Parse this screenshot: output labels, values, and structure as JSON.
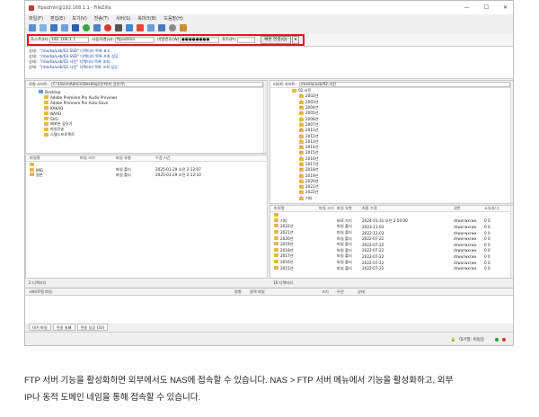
{
  "window": {
    "title": "ftpadmin@192.168.1.1 - FileZilla",
    "controls": [
      "—",
      "☐",
      "✕"
    ]
  },
  "menu": [
    "파일(F)",
    "편집(E)",
    "보기(V)",
    "전송(T)",
    "서버(S)",
    "북마크(B)",
    "도움말(H)"
  ],
  "toolbar_icons": [
    "site-manager-icon",
    "toggle-log-icon",
    "toggle-tree-icon",
    "toggle-remote-tree-icon",
    "toggle-queue-icon",
    "refresh-icon",
    "process-queue-icon",
    "cancel-icon",
    "disconnect-icon",
    "reconnect-icon",
    "filter-icon",
    "compare-icon",
    "sync-browse-icon",
    "search-icon",
    "binoculars-icon"
  ],
  "quickconnect": {
    "host_label": "호스트(H):",
    "host_value": "192.168.1.1",
    "user_label": "사용자명(U):",
    "user_value": "ftpadmin",
    "pass_label": "비밀번호(W):",
    "pass_value": "●●●●●●●●",
    "port_label": "포트(P):",
    "port_value": "",
    "button": "빠른 연결(Q)",
    "dropdown": "▾"
  },
  "log": [
    {
      "k": "상태:",
      "v": "\"/media/usb/02.SSD\" 디렉터리 목록 표시"
    },
    {
      "k": "상태:",
      "v": "\"/media/usb/02.SSD\" 디렉터리 목록 조회 성공"
    },
    {
      "k": "상태:",
      "v": "\"/media/usb/02.사진\" 디렉터리 목록 조회..."
    },
    {
      "k": "상태:",
      "v": "\"/media/usb/02.사진\" 디렉터리 목록 조회 성공"
    }
  ],
  "local": {
    "site_label": "로컬 사이트:",
    "path": "C:\\Users\\Admin\\Desktop\\유저\\지 공유기\\",
    "tree": [
      {
        "indent": 14,
        "label": "Desktop",
        "kind": "folder-blue"
      },
      {
        "indent": 20,
        "label": "Adobe Premiere Pro Audio Previews",
        "kind": "folder"
      },
      {
        "indent": 20,
        "label": "Adobe Premiere Pro Auto-Save",
        "kind": "folder"
      },
      {
        "indent": 20,
        "label": "KAKAO",
        "kind": "folder"
      },
      {
        "indent": 20,
        "label": "NAAD",
        "kind": "folder"
      },
      {
        "indent": 20,
        "label": "SVG",
        "kind": "folder"
      },
      {
        "indent": 20,
        "label": "배포본 공유기",
        "kind": "folder"
      },
      {
        "indent": 20,
        "label": "파일전송",
        "kind": "folder"
      },
      {
        "indent": 20,
        "label": "스텔스프로젝트",
        "kind": "folder"
      }
    ],
    "columns": [
      "파일명",
      "파일 크기",
      "파일 유형",
      "수정 시간"
    ],
    "files": [
      {
        "name": "..",
        "size": "",
        "type": "",
        "mtime": ""
      },
      {
        "name": "IMG",
        "size": "",
        "type": "파일 폴더",
        "mtime": "2025-01-29 오전 2:12:07"
      },
      {
        "name": "원본",
        "size": "",
        "type": "파일 폴더",
        "mtime": "2025-01-29 오전 2:12:10"
      }
    ],
    "status": "2 디렉터리"
  },
  "remote": {
    "site_label": "리모트 사이트:",
    "path": "/media/usb/02.사진",
    "tree": [
      {
        "indent": 24,
        "label": "02.사진",
        "kind": "folder"
      },
      {
        "indent": 32,
        "label": "2002년",
        "kind": "q"
      },
      {
        "indent": 32,
        "label": "2003년",
        "kind": "q"
      },
      {
        "indent": 32,
        "label": "2004년",
        "kind": "q"
      },
      {
        "indent": 32,
        "label": "2005년",
        "kind": "q"
      },
      {
        "indent": 32,
        "label": "2006년",
        "kind": "q"
      },
      {
        "indent": 32,
        "label": "2007년",
        "kind": "q"
      },
      {
        "indent": 32,
        "label": "2011년",
        "kind": "q"
      },
      {
        "indent": 32,
        "label": "2012년",
        "kind": "q"
      },
      {
        "indent": 32,
        "label": "2013년",
        "kind": "q"
      },
      {
        "indent": 32,
        "label": "2014년",
        "kind": "q"
      },
      {
        "indent": 32,
        "label": "2015년",
        "kind": "q"
      },
      {
        "indent": 32,
        "label": "2016년",
        "kind": "q"
      },
      {
        "indent": 32,
        "label": "2017년",
        "kind": "q"
      },
      {
        "indent": 32,
        "label": "2018년",
        "kind": "q"
      },
      {
        "indent": 32,
        "label": "2019년",
        "kind": "q"
      },
      {
        "indent": 32,
        "label": "2020년",
        "kind": "q"
      },
      {
        "indent": 32,
        "label": "2021년",
        "kind": "q"
      },
      {
        "indent": 32,
        "label": "2022년",
        "kind": "q"
      },
      {
        "indent": 32,
        "label": "기타",
        "kind": "q"
      }
    ],
    "columns": [
      "파일명",
      "파일 크기",
      "파일 유형",
      "최종 수정",
      "권한",
      "소유자/그"
    ],
    "files": [
      {
        "name": "..",
        "size": "",
        "type": "",
        "mtime": "",
        "perm": "",
        "owner": ""
      },
      {
        "name": "기타",
        "size": "",
        "type": "바로 가기",
        "mtime": "2024-01-31 오전 2:50:00",
        "perm": "drwxrwxrwx",
        "owner": "0 0"
      },
      {
        "name": "2022년",
        "size": "",
        "type": "파일 폴더",
        "mtime": "2023-11-03",
        "perm": "drwxrwxrwx",
        "owner": "0 0"
      },
      {
        "name": "2021년",
        "size": "",
        "type": "파일 폴더",
        "mtime": "2022-12-03",
        "perm": "drwxrwxrwx",
        "owner": "0 0"
      },
      {
        "name": "2020년",
        "size": "",
        "type": "파일 폴더",
        "mtime": "2022-07-22",
        "perm": "drwxrwxrwx",
        "owner": "0 0"
      },
      {
        "name": "2019년",
        "size": "",
        "type": "파일 폴더",
        "mtime": "2022-07-22",
        "perm": "drwxrwxrwx",
        "owner": "0 0"
      },
      {
        "name": "2018년",
        "size": "",
        "type": "파일 폴더",
        "mtime": "2022-07-22",
        "perm": "drwxrwxrwx",
        "owner": "0 0"
      },
      {
        "name": "2017년",
        "size": "",
        "type": "파일 폴더",
        "mtime": "2022-07-22",
        "perm": "drwxrwxrwx",
        "owner": "0 0"
      },
      {
        "name": "2016년",
        "size": "",
        "type": "파일 폴더",
        "mtime": "2022-07-22",
        "perm": "drwxrwxrwx",
        "owner": "0 0"
      },
      {
        "name": "2015년",
        "size": "",
        "type": "파일 폴더",
        "mtime": "2022-07-22",
        "perm": "drwxrwxrwx",
        "owner": "0 0"
      }
    ],
    "status": "16 디렉터리"
  },
  "queue": {
    "columns": [
      "서버/로컬 파일",
      "방향",
      "원격 파일",
      "크기",
      "우선",
      "상태"
    ]
  },
  "queue_tabs": [
    "대기 파일",
    "전송 실패",
    "전송 성공 (33)"
  ],
  "bottom": {
    "queue_label": "대기열: 비었음"
  },
  "caption": [
    "FTP 서버 기능을 활성화하면 외부에서도 NAS에 접속할 수 있습니다. NAS > FTP 서버 메뉴에서 기능을 활성화하고, 외부",
    "IP나 동적 도메인 네임을 통해 접속할 수 있습니다."
  ],
  "colors": {
    "highlight": "#e0161e",
    "folder": "#e8b84a",
    "link": "#1a3f9a"
  }
}
